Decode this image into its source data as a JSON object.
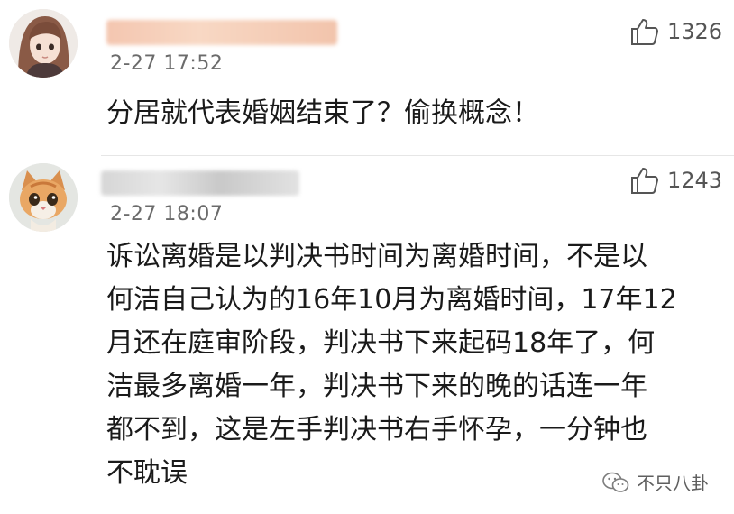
{
  "comments": [
    {
      "time": "2-27 17:52",
      "likes": "1326",
      "text": "分居就代表婚姻结束了？偷换概念！",
      "avatar_icon": "girl-avatar-icon"
    },
    {
      "time": "2-27 18:07",
      "likes": "1243",
      "text": "诉讼离婚是以判决书时间为离婚时间，不是以\n何洁自己认为的16年10月为离婚时间，17年12\n月还在庭审阶段，判决书下来起码18年了，何\n洁最多离婚一年，判决书下来的晚的话连一年\n都不到，这是左手判决书右手怀孕，一分钟也\n不耽误",
      "avatar_icon": "kitten-avatar-icon"
    }
  ],
  "like_icon": "thumbs-up-icon",
  "watermark": {
    "text": "不只八卦",
    "icon": "wechat-icon"
  }
}
